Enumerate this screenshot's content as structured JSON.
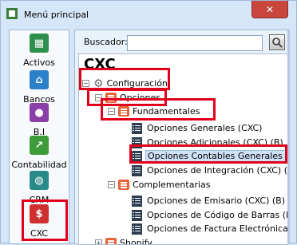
{
  "window": {
    "title": "Menú principal",
    "close_label": "✕"
  },
  "nav": {
    "items": [
      {
        "label": "Activos",
        "icon": "activos-icon",
        "color": "#2f8f4e"
      },
      {
        "label": "Bancos",
        "icon": "bank-icon",
        "color": "#2c7fc9"
      },
      {
        "label": "B.I",
        "icon": "bi-icon",
        "color": "#8a3fa8"
      },
      {
        "label": "Contabilidad",
        "icon": "contabilidad-icon",
        "color": "#3e9c3a"
      },
      {
        "label": "CRM",
        "icon": "crm-icon",
        "color": "#2a8a8a"
      },
      {
        "label": "CXC",
        "icon": "cxc-icon",
        "color": "#cf2f2f"
      }
    ]
  },
  "search": {
    "label": "Buscador:",
    "value": ""
  },
  "tree": {
    "header": "CXC",
    "root": {
      "label": "Configuración"
    },
    "opciones": {
      "label": "Opciones"
    },
    "fundamentales": {
      "label": "Fundamentales"
    },
    "fund_items": [
      "Opciones Generales (CXC)",
      "Opciones Adicionales (CXC) (B)",
      "Opciones Contables Generales (CX",
      "Opciones de Integración (CXC) (B)"
    ],
    "complementarias": {
      "label": "Complementarias"
    },
    "comp_items": [
      "Opciones de Emisario (CXC) (B)",
      "Opciones de Código de Barras (B)",
      "Opciones de Factura Electrónica (CX"
    ],
    "shopify": {
      "label": "Shopify"
    }
  },
  "colors": {
    "highlight": "#e0001b",
    "accent": "#e8643a"
  }
}
